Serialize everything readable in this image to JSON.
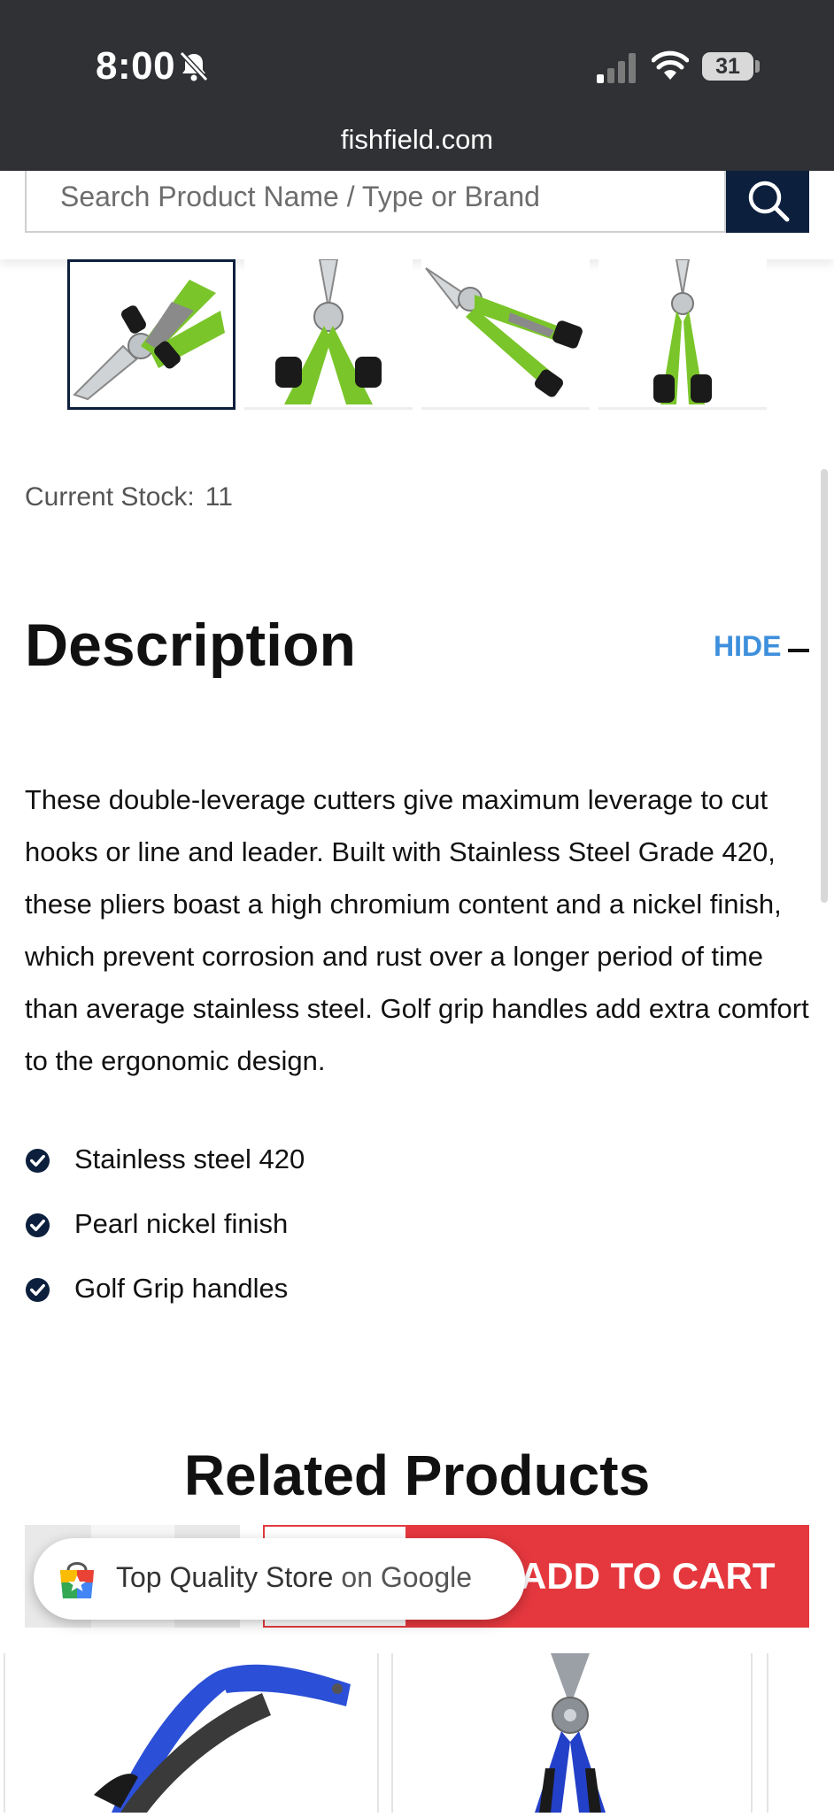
{
  "status_bar": {
    "time": "8:00",
    "battery": "31",
    "url": "fishfield.com"
  },
  "search": {
    "placeholder": "Search Product Name / Type or Brand"
  },
  "product": {
    "stock_label": "Current Stock:",
    "stock_value": "11",
    "thumbnails": [
      "thumb-side-view",
      "thumb-front-view",
      "thumb-angled-view",
      "thumb-closed-view"
    ]
  },
  "description": {
    "title": "Description",
    "toggle_label": "HIDE",
    "body": "These double-leverage cutters give maximum leverage to cut hooks or line and leader. Built with Stainless Steel Grade 420, these pliers boast a high chromium content and a nickel finish, which prevent corrosion and rust over a longer period of time than average stainless steel. Golf grip handles add extra comfort to the ergonomic design.",
    "features": [
      "Stainless steel 420",
      "Pearl nickel finish",
      "Golf Grip handles"
    ]
  },
  "related": {
    "title": "Related Products",
    "add_to_cart": "ADD TO CART"
  },
  "google_badge": {
    "text": "Top Quality Store",
    "brand": "on Google"
  },
  "colors": {
    "navy": "#0c1f3d",
    "accent_blue": "#3e8fdc",
    "cart_red": "#e5383e",
    "grip_green": "#7ac52a"
  }
}
